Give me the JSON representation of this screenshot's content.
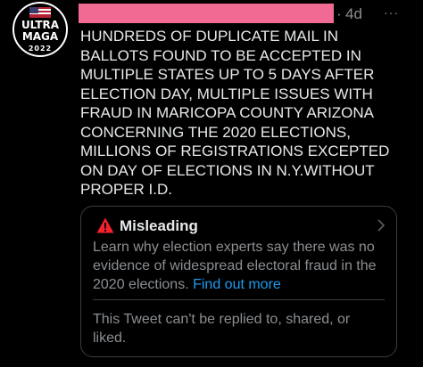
{
  "avatar": {
    "line1": "ULTRA",
    "line2": "MAGA",
    "year": "2022"
  },
  "header": {
    "separator": "·",
    "time": "4d",
    "more_label": "···"
  },
  "tweet": {
    "text": "HUNDREDS OF DUPLICATE MAIL IN\nBALLOTS FOUND TO BE ACCEPTED IN\nMULTIPLE STATES UP TO 5 DAYS AFTER\nELECTION DAY, MULTIPLE ISSUES WITH\nFRAUD IN MARICOPA COUNTY ARIZONA\nCONCERNING THE 2020 ELECTIONS,\nMILLIONS OF REGISTRATIONS EXCEPTED\nON DAY OF ELECTIONS IN N.Y.WITHOUT\nPROPER I.D."
  },
  "notice": {
    "title": "Misleading",
    "body": "Learn why election experts say there was no evidence of widespread electoral fraud in the 2020 elections.",
    "link": "Find out more",
    "restriction": "This Tweet can't be replied to, shared, or liked."
  },
  "colors": {
    "background": "#000000",
    "text": "#e7e9ea",
    "muted": "#8b8f93",
    "link": "#1d9bf0",
    "warning": "#f4212e",
    "redaction": "#f06a93"
  },
  "icons": {
    "more": "more-dots-icon",
    "warning": "warning-triangle-icon",
    "chevron": "chevron-right-icon"
  }
}
